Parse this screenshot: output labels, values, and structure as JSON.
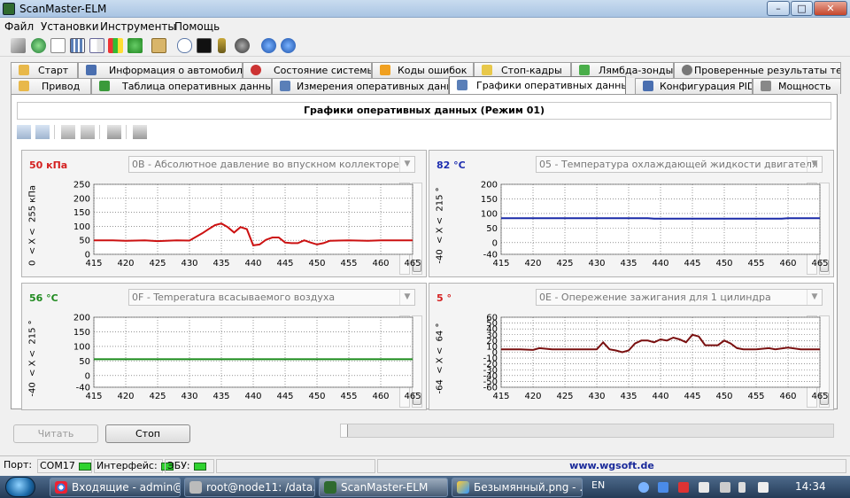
{
  "window": {
    "title": "ScanMaster-ELM",
    "minimize_glyph": "–",
    "maximize_glyph": "□",
    "close_glyph": "✕"
  },
  "menu": [
    "Файл",
    "Установки",
    "Инструменты",
    "Помощь"
  ],
  "toolbar_icons": [
    "wrench-icon",
    "globe-icon",
    "document-icon",
    "grid-icon",
    "chart-icon",
    "ecu-icon",
    "clipboard-icon",
    "comment-icon",
    "terminal-icon",
    "battery-icon",
    "disc-icon",
    "info-icon",
    "question-icon"
  ],
  "tabs_row1": [
    "Старт",
    "Информация о автомобиле",
    "Состояние системы",
    "Коды ошибок",
    "Стоп-кадры",
    "Лямбда-зонды",
    "Проверенные результаты теста"
  ],
  "tabs_row2": [
    "Привод",
    "Таблица оперативных данных",
    "Измерения оперативных данных",
    "Графики оперативных данных",
    "Конфигурация PID",
    "Мощность"
  ],
  "active_tab": "Графики оперативных данных",
  "panel_title": "Графики оперативных данных (Режим 01)",
  "graph_toolbar": [
    "add-graph-icon",
    "remove-graph-icon",
    "open-icon",
    "save-icon",
    "print-preview-icon",
    "print-icon"
  ],
  "charts": [
    {
      "value": "50 кПа",
      "value_color": "#d42020",
      "pid": "0B - Абсолютное давление во впускном коллекторе",
      "yband": [
        "0",
        "< X <",
        "255 кПа"
      ]
    },
    {
      "value": "82 °C",
      "value_color": "#1f2fb0",
      "pid": "05 - Температура охлаждающей жидкости двигателя",
      "yband": [
        "-40",
        "< X <",
        "215 °"
      ]
    },
    {
      "value": "56 °C",
      "value_color": "#1f8a1f",
      "pid": "0F - Temperatura всасываемого воздуха",
      "yband": [
        "-40",
        "< X <",
        "215 °"
      ]
    },
    {
      "value": "5 °",
      "value_color": "#d42020",
      "pid": "0E - Опережение зажигания для 1 цилиндра",
      "yband": [
        "-64",
        "< X <",
        "64 °"
      ]
    }
  ],
  "chart_data": [
    {
      "type": "line",
      "xlim": [
        415,
        465
      ],
      "ylim": [
        0,
        250
      ],
      "xticks": [
        415,
        420,
        425,
        430,
        435,
        440,
        445,
        450,
        455,
        460,
        465
      ],
      "yticks": [
        0,
        50,
        100,
        150,
        200,
        250
      ],
      "grid": true,
      "color": "#cc1111",
      "series": [
        {
          "x": [
            415,
            418,
            420,
            423,
            425,
            428,
            430,
            432,
            433,
            434,
            435,
            436,
            437,
            438,
            439,
            440,
            441,
            442,
            443,
            444,
            445,
            446,
            447,
            448,
            449,
            450,
            451,
            452,
            455,
            458,
            460,
            462,
            465
          ],
          "y": [
            50,
            50,
            48,
            50,
            47,
            50,
            49,
            75,
            90,
            104,
            110,
            97,
            78,
            97,
            90,
            32,
            35,
            52,
            60,
            60,
            42,
            40,
            40,
            50,
            42,
            35,
            40,
            48,
            50,
            48,
            50,
            50,
            50
          ]
        }
      ]
    },
    {
      "type": "line",
      "xlim": [
        415,
        465
      ],
      "ylim": [
        -40,
        200
      ],
      "xticks": [
        415,
        420,
        425,
        430,
        435,
        440,
        445,
        450,
        455,
        460,
        465
      ],
      "yticks": [
        -40,
        0,
        50,
        100,
        150,
        200
      ],
      "grid": true,
      "color": "#1a2aa8",
      "series": [
        {
          "x": [
            415,
            425,
            435,
            438,
            439,
            445,
            455,
            459,
            460,
            465
          ],
          "y": [
            84,
            84,
            84,
            84,
            82,
            82,
            82,
            82,
            84,
            84
          ]
        }
      ]
    },
    {
      "type": "line",
      "xlim": [
        415,
        465
      ],
      "ylim": [
        -40,
        200
      ],
      "xticks": [
        415,
        420,
        425,
        430,
        435,
        440,
        445,
        450,
        455,
        460,
        465
      ],
      "yticks": [
        -40,
        0,
        50,
        100,
        150,
        200
      ],
      "grid": true,
      "color": "#1a8a1a",
      "series": [
        {
          "x": [
            415,
            465
          ],
          "y": [
            56,
            56
          ]
        }
      ]
    },
    {
      "type": "line",
      "xlim": [
        415,
        465
      ],
      "ylim": [
        -60,
        60
      ],
      "xticks": [
        415,
        420,
        425,
        430,
        435,
        440,
        445,
        450,
        455,
        460,
        465
      ],
      "yticks": [
        -60,
        -50,
        -40,
        -30,
        -20,
        -10,
        0,
        10,
        20,
        30,
        40,
        50,
        60
      ],
      "grid": true,
      "color": "#7a1010",
      "series": [
        {
          "x": [
            415,
            418,
            420,
            421,
            423,
            425,
            428,
            430,
            431,
            432,
            433,
            434,
            435,
            436,
            437,
            438,
            439,
            440,
            441,
            442,
            443,
            444,
            445,
            446,
            447,
            448,
            449,
            450,
            451,
            452,
            453,
            455,
            457,
            458,
            460,
            462,
            465
          ],
          "y": [
            5,
            5,
            4,
            7,
            5,
            5,
            5,
            5,
            17,
            5,
            3,
            0,
            3,
            15,
            20,
            20,
            17,
            22,
            20,
            25,
            22,
            17,
            30,
            27,
            12,
            12,
            12,
            20,
            15,
            7,
            5,
            5,
            7,
            5,
            8,
            5,
            5
          ]
        }
      ]
    }
  ],
  "buttons": {
    "read": "Читать",
    "stop": "Стоп"
  },
  "status": {
    "port_label": "Порт:",
    "port": "COM17",
    "interface": "Интерфейс:",
    "ecu": "ЭБУ:",
    "url": "www.wgsoft.de"
  },
  "taskbar": {
    "items": [
      "Входящие - admin@...",
      "root@node11: /data...",
      "ScanMaster-ELM",
      "Безымянный.png - ..."
    ],
    "lang": "EN",
    "clock": "14:34"
  }
}
